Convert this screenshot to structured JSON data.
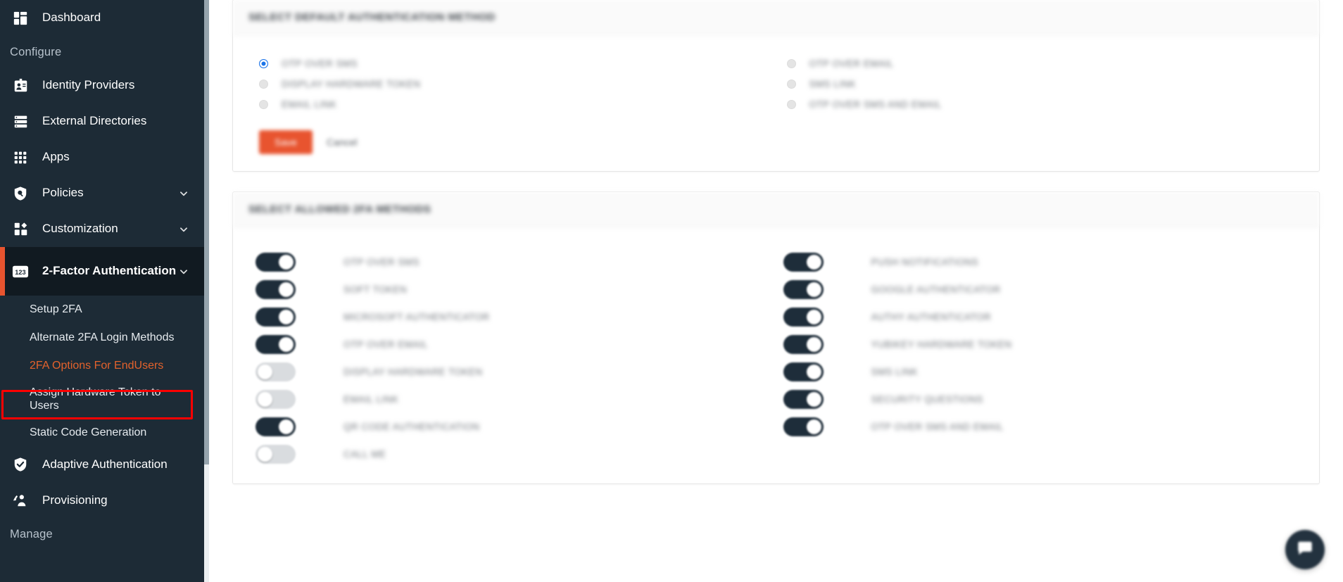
{
  "colors": {
    "sidebar_bg": "#1d2b36",
    "sidebar_active_bg": "#111a21",
    "accent_orange": "#e8542f",
    "highlight_red": "#ff0000",
    "toggle_on": "#1e2d3a",
    "toggle_off": "#d9dcdf",
    "radio_on": "#1a73e8"
  },
  "sidebar": {
    "top_item": {
      "label": "Dashboard",
      "icon": "dashboard-icon"
    },
    "section_configure": "Configure",
    "section_manage": "Manage",
    "items": [
      {
        "label": "Identity Providers",
        "icon": "id-card-icon",
        "chevron": false
      },
      {
        "label": "External Directories",
        "icon": "directory-icon",
        "chevron": false
      },
      {
        "label": "Apps",
        "icon": "apps-grid-icon",
        "chevron": false
      },
      {
        "label": "Policies",
        "icon": "shield-search-icon",
        "chevron": true
      },
      {
        "label": "Customization",
        "icon": "customization-icon",
        "chevron": true
      }
    ],
    "active_item": {
      "label": "2-Factor Authentication",
      "icon": "numeric-123-icon",
      "chevron": true
    },
    "sub_items": [
      {
        "label": "Setup 2FA",
        "highlighted": false
      },
      {
        "label": "Alternate 2FA Login Methods",
        "highlighted": false
      },
      {
        "label": "2FA Options For EndUsers",
        "highlighted": true
      },
      {
        "label": "Assign Hardware Token to Users",
        "highlighted": false
      },
      {
        "label": "Static Code Generation",
        "highlighted": false
      }
    ],
    "bottom_items": [
      {
        "label": "Adaptive Authentication",
        "icon": "shield-check-icon"
      },
      {
        "label": "Provisioning",
        "icon": "provisioning-icon"
      }
    ]
  },
  "main": {
    "default_method_card": {
      "title": "SELECT DEFAULT AUTHENTICATION METHOD",
      "left_options": [
        {
          "label": "OTP OVER SMS",
          "selected": true
        },
        {
          "label": "DISPLAY HARDWARE TOKEN",
          "selected": false
        },
        {
          "label": "EMAIL LINK",
          "selected": false
        }
      ],
      "right_options": [
        {
          "label": "OTP OVER EMAIL",
          "selected": false
        },
        {
          "label": "SMS LINK",
          "selected": false
        },
        {
          "label": "OTP OVER SMS AND EMAIL",
          "selected": false
        }
      ],
      "save_label": "Save",
      "cancel_label": "Cancel"
    },
    "allowed_methods_card": {
      "title": "SELECT ALLOWED 2FA METHODS",
      "left_toggles": [
        {
          "label": "OTP OVER SMS",
          "on": true
        },
        {
          "label": "SOFT TOKEN",
          "on": true
        },
        {
          "label": "MICROSOFT AUTHENTICATOR",
          "on": true
        },
        {
          "label": "OTP OVER EMAIL",
          "on": true
        },
        {
          "label": "DISPLAY HARDWARE TOKEN",
          "on": false
        },
        {
          "label": "EMAIL LINK",
          "on": false
        },
        {
          "label": "QR CODE AUTHENTICATION",
          "on": true
        },
        {
          "label": "CALL ME",
          "on": false
        }
      ],
      "right_toggles": [
        {
          "label": "PUSH NOTIFICATIONS",
          "on": true
        },
        {
          "label": "GOOGLE AUTHENTICATOR",
          "on": true
        },
        {
          "label": "AUTHY AUTHENTICATOR",
          "on": true
        },
        {
          "label": "YUBIKEY HARDWARE TOKEN",
          "on": true
        },
        {
          "label": "SMS LINK",
          "on": true
        },
        {
          "label": "SECURITY QUESTIONS",
          "on": true
        },
        {
          "label": "OTP OVER SMS AND EMAIL",
          "on": true
        }
      ]
    }
  },
  "chat_widget": {
    "icon": "chat-bubble-icon"
  }
}
